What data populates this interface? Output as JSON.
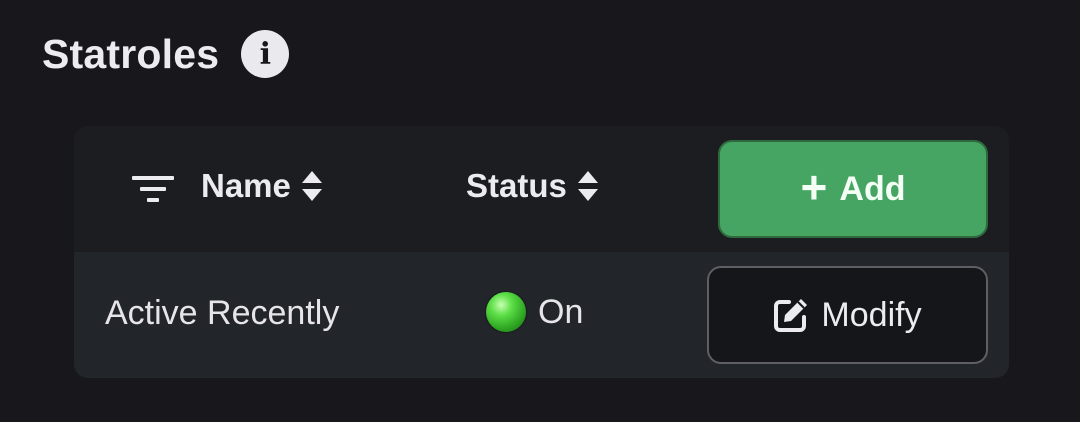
{
  "page": {
    "title": "Statroles"
  },
  "table": {
    "columns": [
      {
        "label": "Name",
        "sortable": true
      },
      {
        "label": "Status",
        "sortable": true
      }
    ],
    "add_button_label": "Add",
    "rows": [
      {
        "name": "Active Recently",
        "status": "On",
        "status_color": "#3cc52c",
        "action_label": "Modify"
      }
    ]
  },
  "colors": {
    "background": "#18181c",
    "card": "#202226",
    "accent_green": "#46a562",
    "text": "#ececf0"
  },
  "icons": {
    "info": "info-icon",
    "filter": "filter-icon",
    "sort": "sort-icon",
    "add": "plus-icon",
    "edit": "edit-icon"
  }
}
